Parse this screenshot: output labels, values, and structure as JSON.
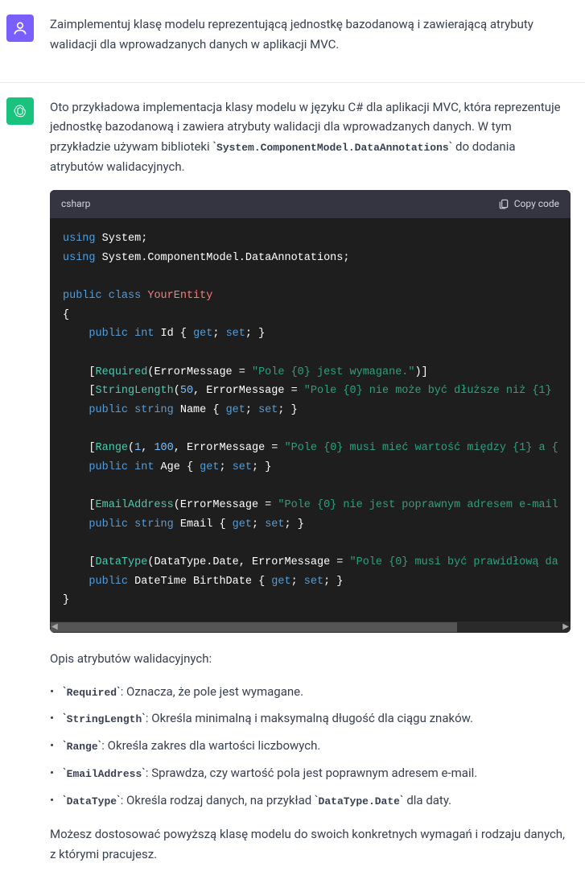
{
  "user_message": "Zaimplementuj klasę modelu reprezentującą jednostkę bazodanową i zawierającą atrybuty walidacji dla wprowadzanych danych w aplikacji MVC.",
  "assistant": {
    "intro_part1": "Oto przykładowa implementacja klasy modelu w języku C# dla aplikacji MVC, która reprezentuje jednostkę bazodanową i zawiera atrybuty walidacji dla wprowadzanych danych. W tym przykładzie używam biblioteki ",
    "intro_code": "System.ComponentModel.DataAnnotations",
    "intro_part2": " do dodania atrybutów walidacyjnych.",
    "code_lang": "csharp",
    "copy_label": "Copy code",
    "attr_heading": "Opis atrybutów walidacyjnych:",
    "bullets": [
      {
        "term": "Required",
        "desc": ": Oznacza, że pole jest wymagane."
      },
      {
        "term": "StringLength",
        "desc": ": Określa minimalną i maksymalną długość dla ciągu znaków."
      },
      {
        "term": "Range",
        "desc": ": Określa zakres dla wartości liczbowych."
      },
      {
        "term": "EmailAddress",
        "desc": ": Sprawdza, czy wartość pola jest poprawnym adresem e-mail."
      },
      {
        "term": "DataType",
        "desc": ": Określa rodzaj danych, na przykład ",
        "term2": "DataType.Date",
        "desc2": " dla daty."
      }
    ],
    "outro": "Możesz dostosować powyższą klasę modelu do swoich konkretnych wymagań i rodzaju danych, z którymi pracujesz.",
    "code": {
      "kw_using": "using",
      "ns_system": "System;",
      "ns_data_annotations": "System.ComponentModel.DataAnnotations;",
      "kw_public": "public",
      "kw_class": "class",
      "cls_name": "YourEntity",
      "type_int": "int",
      "type_string": "string",
      "type_datetime": "DateTime",
      "prop_id": "Id",
      "prop_name": "Name",
      "prop_age": "Age",
      "prop_email": "Email",
      "prop_birth": "BirthDate",
      "kw_get": "get",
      "kw_set": "set",
      "attr_required": "Required",
      "attr_stringlength": "StringLength",
      "attr_range": "Range",
      "attr_email": "EmailAddress",
      "attr_datatype": "DataType",
      "param_error": "ErrorMessage = ",
      "txt_required": "\"Pole {0} jest wymagane.\"",
      "txt_strlen": "\"Pole {0} nie może być dłuższe niż {1}",
      "txt_range": "\"Pole {0} musi mieć wartość między {1} a {",
      "txt_email": "\"Pole {0} nie jest poprawnym adresem e-mail",
      "txt_date": "\"Pole {0} musi być prawidłową da",
      "num_50": "50",
      "num_1": "1",
      "num_100": "100",
      "datatype_date": "DataType.Date"
    }
  }
}
